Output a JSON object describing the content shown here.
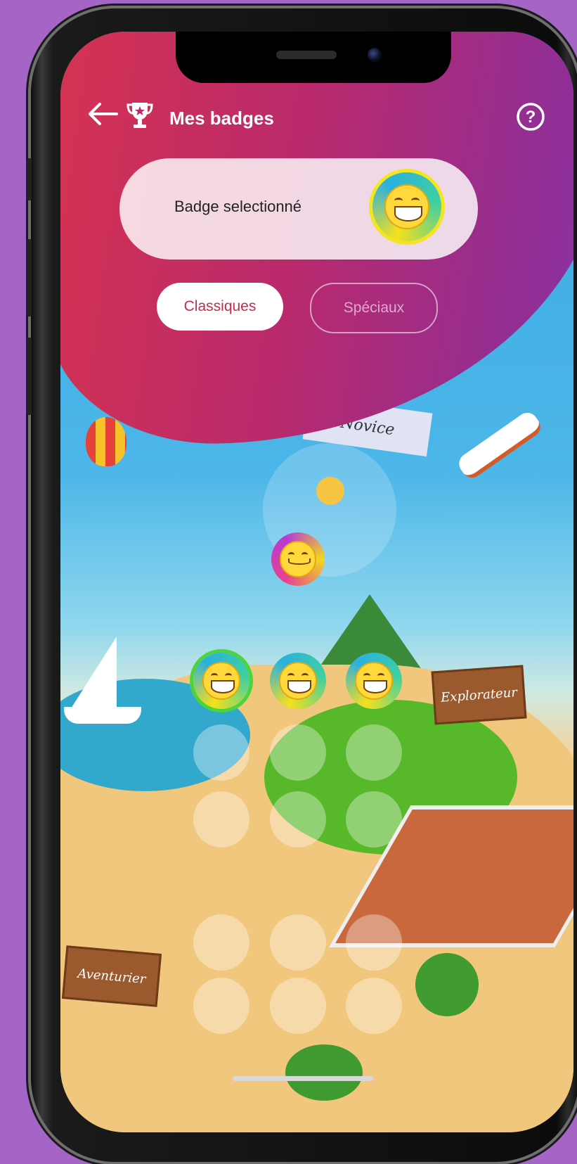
{
  "header": {
    "title": "Mes badges",
    "back_icon": "arrow-left-icon",
    "trophy_icon": "trophy-icon",
    "help_icon": "question-icon",
    "help_symbol": "?"
  },
  "selected_badge": {
    "label": "Badge selectionné",
    "emoji_icon": "grinning-face-icon"
  },
  "tabs": [
    {
      "label": "Classiques",
      "active": true
    },
    {
      "label": "Spéciaux",
      "active": false
    }
  ],
  "map": {
    "banner_text": "Novice",
    "sign_explorateur": "Explorateur",
    "sign_aventurier": "Aventurier"
  },
  "badges": [
    {
      "name": "angel-face-icon",
      "unlocked": true,
      "selected": false
    },
    {
      "name": "grinning-face-icon",
      "unlocked": true,
      "selected": true
    },
    {
      "name": "cowboy-face-icon",
      "unlocked": true,
      "selected": false
    },
    {
      "name": "tears-of-joy-face-icon",
      "unlocked": true,
      "selected": false
    }
  ],
  "colors": {
    "header_start": "#d7334f",
    "header_end": "#8d35b1",
    "accent": "#c72c4a",
    "background": "#a565c6"
  }
}
